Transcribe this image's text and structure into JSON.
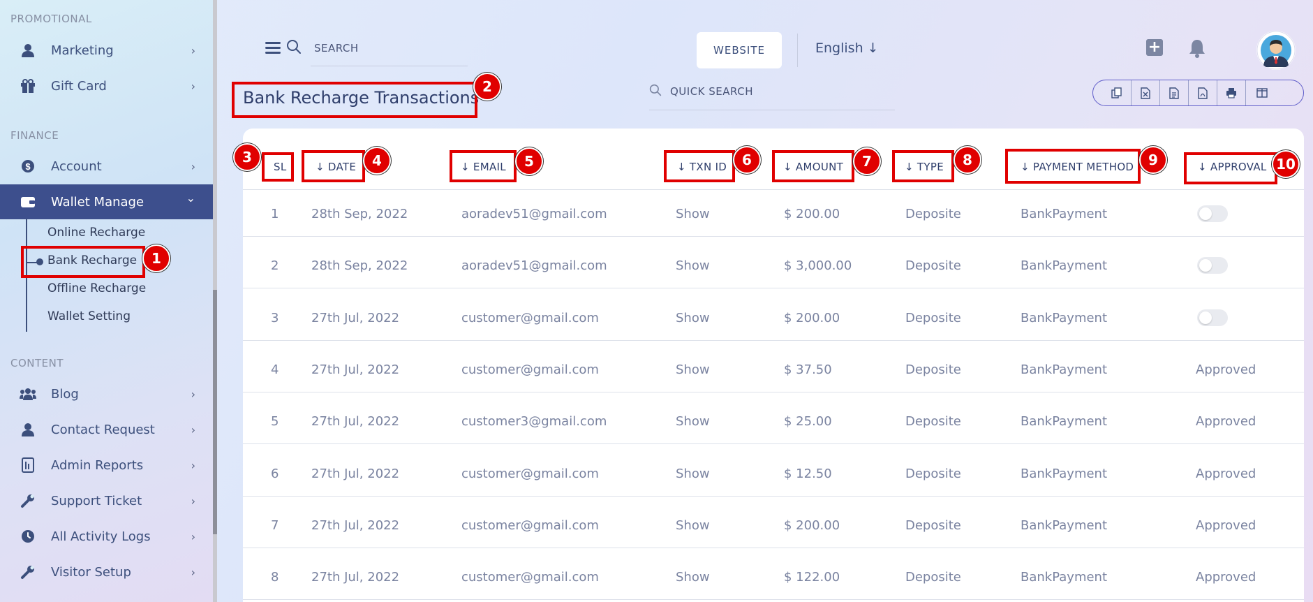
{
  "sidebar": {
    "sections": {
      "promotional": "PROMOTIONAL",
      "finance": "FINANCE",
      "content": "CONTENT"
    },
    "items": {
      "marketing": "Marketing",
      "gift_card": "Gift Card",
      "account": "Account",
      "wallet_manage": "Wallet Manage",
      "blog": "Blog",
      "contact_request": "Contact Request",
      "admin_reports": "Admin Reports",
      "support_ticket": "Support Ticket",
      "all_activity_logs": "All Activity Logs",
      "visitor_setup": "Visitor Setup"
    },
    "wallet_sub": {
      "online": "Online Recharge",
      "bank": "Bank Recharge",
      "offline": "Offline Recharge",
      "setting": "Wallet Setting"
    },
    "chevron": "›",
    "chevron_down": "⌄"
  },
  "header": {
    "search_label": "SEARCH",
    "website_btn": "WEBSITE",
    "language": "English ↓"
  },
  "page": {
    "title": "Bank Recharge Transactions",
    "quick_search": "QUICK SEARCH"
  },
  "annotations": [
    "1",
    "2",
    "3",
    "4",
    "5",
    "6",
    "7",
    "8",
    "9",
    "10"
  ],
  "table": {
    "headers": {
      "sl": "SL",
      "date": "↓ DATE",
      "email": "↓ EMAIL",
      "txn": "↓ TXN ID",
      "amount": "↓ AMOUNT",
      "type": "↓ TYPE",
      "payment": "↓ PAYMENT METHOD",
      "approval": "↓ APPROVAL"
    },
    "rows": [
      {
        "sl": "1",
        "date": "28th Sep, 2022",
        "email": "aoradev51@gmail.com",
        "txn": "Show",
        "amount": "$ 200.00",
        "type": "Deposite",
        "method": "BankPayment",
        "approval": ""
      },
      {
        "sl": "2",
        "date": "28th Sep, 2022",
        "email": "aoradev51@gmail.com",
        "txn": "Show",
        "amount": "$ 3,000.00",
        "type": "Deposite",
        "method": "BankPayment",
        "approval": ""
      },
      {
        "sl": "3",
        "date": "27th Jul, 2022",
        "email": "customer@gmail.com",
        "txn": "Show",
        "amount": "$ 200.00",
        "type": "Deposite",
        "method": "BankPayment",
        "approval": ""
      },
      {
        "sl": "4",
        "date": "27th Jul, 2022",
        "email": "customer@gmail.com",
        "txn": "Show",
        "amount": "$ 37.50",
        "type": "Deposite",
        "method": "BankPayment",
        "approval": "Approved"
      },
      {
        "sl": "5",
        "date": "27th Jul, 2022",
        "email": "customer3@gmail.com",
        "txn": "Show",
        "amount": "$ 25.00",
        "type": "Deposite",
        "method": "BankPayment",
        "approval": "Approved"
      },
      {
        "sl": "6",
        "date": "27th Jul, 2022",
        "email": "customer@gmail.com",
        "txn": "Show",
        "amount": "$ 12.50",
        "type": "Deposite",
        "method": "BankPayment",
        "approval": "Approved"
      },
      {
        "sl": "7",
        "date": "27th Jul, 2022",
        "email": "customer@gmail.com",
        "txn": "Show",
        "amount": "$ 200.00",
        "type": "Deposite",
        "method": "BankPayment",
        "approval": "Approved"
      },
      {
        "sl": "8",
        "date": "27th Jul, 2022",
        "email": "customer@gmail.com",
        "txn": "Show",
        "amount": "$ 122.00",
        "type": "Deposite",
        "method": "BankPayment",
        "approval": "Approved"
      }
    ]
  },
  "colors": {
    "accent": "#3d4f8d",
    "annotation": "#e00000",
    "text": "#2f3e6b",
    "muted": "#7a83a0"
  }
}
